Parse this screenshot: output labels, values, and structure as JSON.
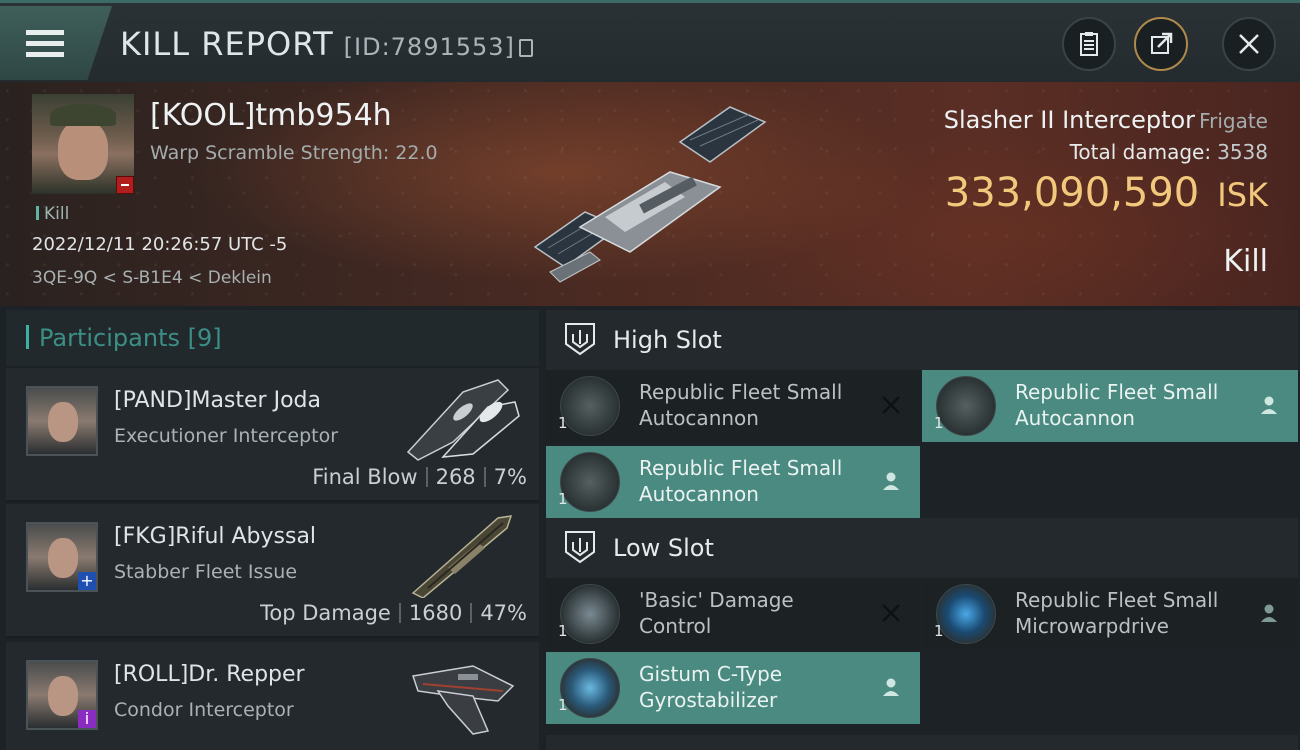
{
  "header": {
    "title": "KILL REPORT",
    "report_id": "[ID:7891553]"
  },
  "victim": {
    "name": "[KOOL]tmb954h",
    "warp_scramble": "Warp Scramble Strength: 22.0",
    "tag": "Kill",
    "datetime": "2022/12/11 20:26:57 UTC -5",
    "location": "3QE-9Q < S-B1E4 < Deklein",
    "ship_name": "Slasher II Interceptor",
    "ship_class": "Frigate",
    "damage_label": "Total damage:",
    "damage_value": "3538",
    "isk_value": "333,090,590",
    "isk_unit": "ISK",
    "report_type": "Kill"
  },
  "participants": {
    "label": "Participants",
    "count": "[9]",
    "items": [
      {
        "name": "[PAND]Master Joda",
        "ship": "Executioner Interceptor",
        "role": "Final Blow",
        "damage": "268",
        "percent": "7%"
      },
      {
        "name": "[FKG]Riful Abyssal",
        "ship": "Stabber Fleet Issue",
        "role": "Top Damage",
        "damage": "1680",
        "percent": "47%"
      },
      {
        "name": "[ROLL]Dr. Repper",
        "ship": "Condor Interceptor",
        "role": "",
        "damage": "",
        "percent": ""
      }
    ]
  },
  "slots": {
    "high": {
      "label": "High Slot",
      "modules": [
        {
          "name": "Republic Fleet Small Autocannon",
          "qty": "1",
          "state": "destroyed"
        },
        {
          "name": "Republic Fleet Small Autocannon",
          "qty": "1",
          "state": "dropped"
        },
        {
          "name": "Republic Fleet Small Autocannon",
          "qty": "1",
          "state": "dropped"
        }
      ]
    },
    "low": {
      "label": "Low Slot",
      "modules": [
        {
          "name": "'Basic' Damage Control",
          "qty": "1",
          "state": "destroyed"
        },
        {
          "name": "Republic Fleet Small Microwarpdrive",
          "qty": "1",
          "state": "dropped"
        },
        {
          "name": "Gistum C-Type Gyrostabilizer",
          "qty": "1",
          "state": "dropped"
        }
      ]
    }
  },
  "colors": {
    "accent": "#3fb09f",
    "isk": "#f2c97c",
    "dropped_bg": "#4a8a80",
    "destroyed_bg": "#1c2124"
  },
  "icons": {
    "menu": "menu-icon",
    "report": "clipboard-icon",
    "share": "share-icon",
    "close": "close-icon",
    "slot": "slot-shield-icon",
    "destroyed": "x-icon",
    "dropped": "person-icon"
  }
}
